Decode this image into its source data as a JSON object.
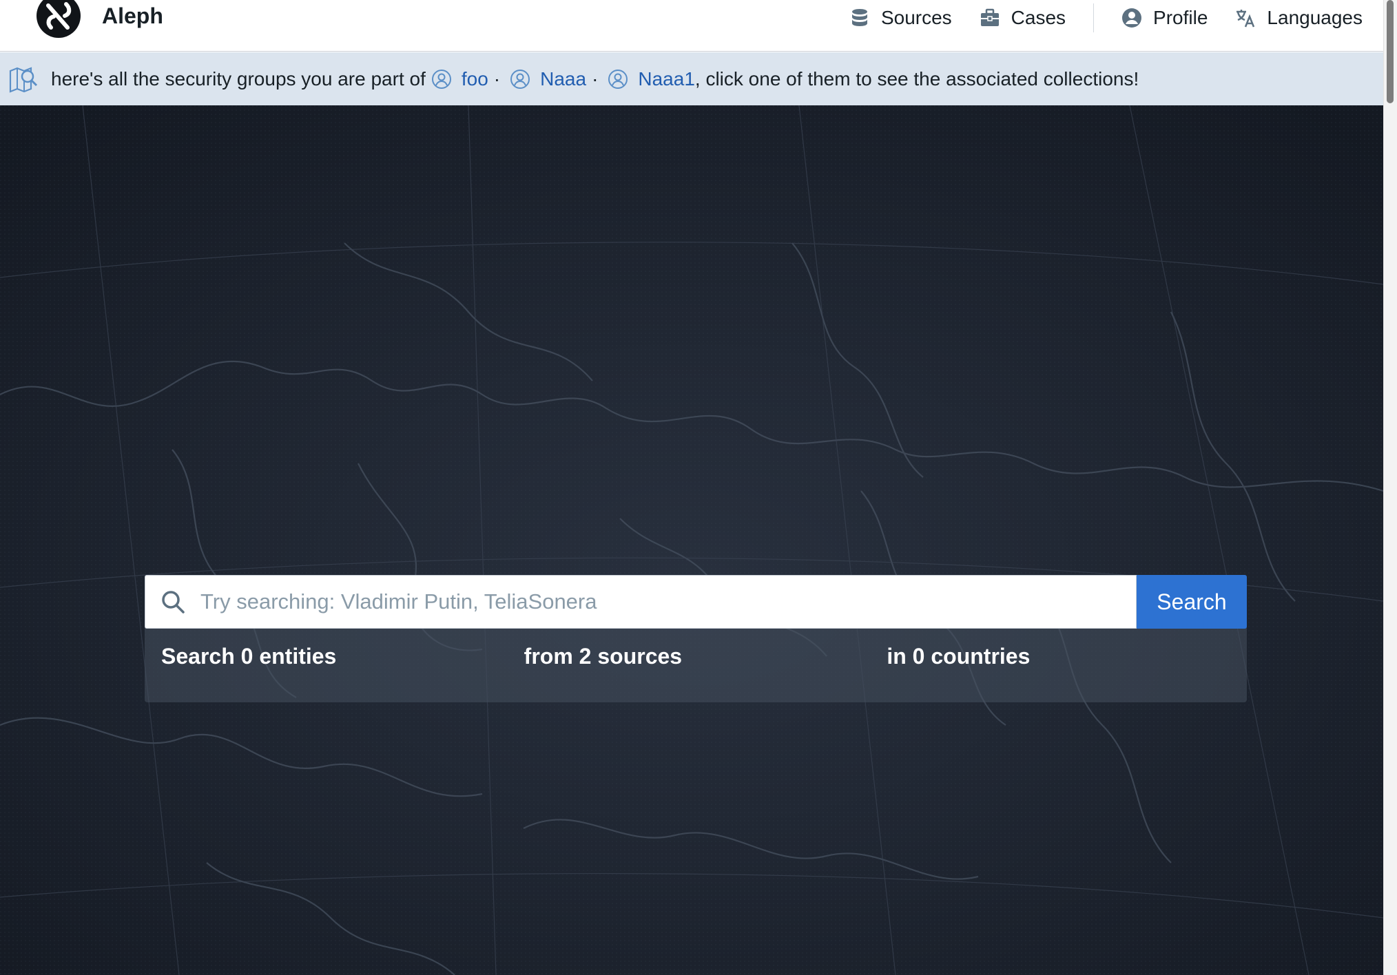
{
  "navbar": {
    "brand_name": "Aleph",
    "brand_icon": "aleph-logo-icon",
    "items": [
      {
        "label": "Sources",
        "icon": "database-icon"
      },
      {
        "label": "Cases",
        "icon": "briefcase-icon"
      },
      {
        "label": "Profile",
        "icon": "user-icon"
      },
      {
        "label": "Languages",
        "icon": "translate-icon"
      }
    ]
  },
  "callout": {
    "icon": "search-map-icon",
    "prefix": "here's all the security groups you are part of",
    "groups": [
      {
        "label": "foo",
        "icon": "user-circle-icon"
      },
      {
        "label": "Naaa",
        "icon": "user-circle-icon"
      },
      {
        "label": "Naaa1",
        "icon": "user-circle-icon"
      }
    ],
    "separator": "·",
    "suffix": ", click one of them to see the associated collections!"
  },
  "search": {
    "placeholder": "Try searching: Vladimir Putin, TeliaSonera",
    "value": "",
    "button_label": "Search",
    "icon": "search-icon"
  },
  "stats": {
    "entities": "Search 0 entities",
    "sources": "from 2 sources",
    "countries": "in 0 countries"
  },
  "colors": {
    "accent": "#2d72d2",
    "link": "#215db0",
    "callout_bg": "#dbe4ee",
    "hero_bg": "#191f2a"
  }
}
